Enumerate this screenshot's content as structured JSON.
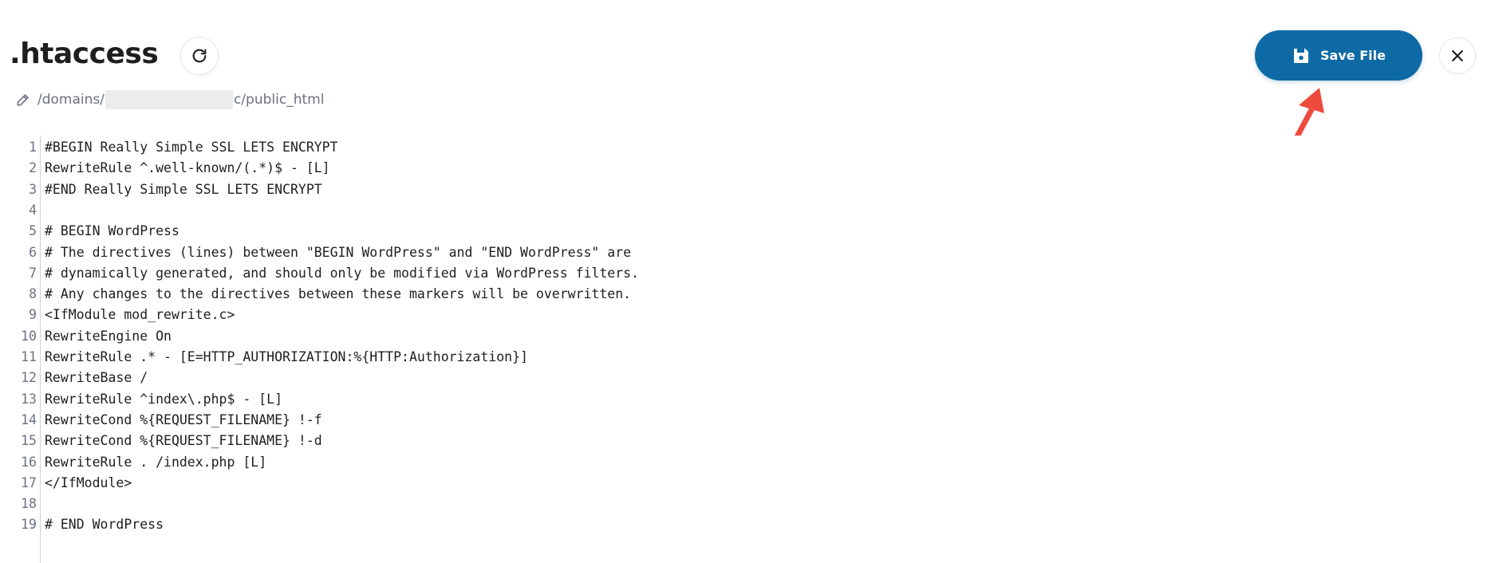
{
  "file": {
    "title": ".htaccess",
    "path_prefix": "/domains/",
    "path_suffix": "c/public_html"
  },
  "toolbar": {
    "save_label": "Save File"
  },
  "icons": {
    "refresh": "refresh-icon",
    "edit": "pencil-icon",
    "save": "floppy-disk-icon",
    "close": "close-icon",
    "annotation": "red-arrow-icon"
  },
  "colors": {
    "accent": "#0e6aa5",
    "annotation_arrow": "#ee4b3f",
    "text": "#1d1e20",
    "muted": "#6d7081"
  },
  "editor": {
    "lines": [
      {
        "num": "1",
        "text": "#BEGIN Really Simple SSL LETS ENCRYPT"
      },
      {
        "num": "2",
        "text": "RewriteRule ^.well-known/(.*)$ - [L]"
      },
      {
        "num": "3",
        "text": "#END Really Simple SSL LETS ENCRYPT"
      },
      {
        "num": "4",
        "text": ""
      },
      {
        "num": "5",
        "text": "# BEGIN WordPress"
      },
      {
        "num": "6",
        "text": "# The directives (lines) between \"BEGIN WordPress\" and \"END WordPress\" are"
      },
      {
        "num": "7",
        "text": "# dynamically generated, and should only be modified via WordPress filters."
      },
      {
        "num": "8",
        "text": "# Any changes to the directives between these markers will be overwritten."
      },
      {
        "num": "9",
        "text": "<IfModule mod_rewrite.c>"
      },
      {
        "num": "10",
        "text": "RewriteEngine On"
      },
      {
        "num": "11",
        "text": "RewriteRule .* - [E=HTTP_AUTHORIZATION:%{HTTP:Authorization}]"
      },
      {
        "num": "12",
        "text": "RewriteBase /"
      },
      {
        "num": "13",
        "text": "RewriteRule ^index\\.php$ - [L]"
      },
      {
        "num": "14",
        "text": "RewriteCond %{REQUEST_FILENAME} !-f"
      },
      {
        "num": "15",
        "text": "RewriteCond %{REQUEST_FILENAME} !-d"
      },
      {
        "num": "16",
        "text": "RewriteRule . /index.php [L]"
      },
      {
        "num": "17",
        "text": "</IfModule>"
      },
      {
        "num": "18",
        "text": ""
      },
      {
        "num": "19",
        "text": "# END WordPress"
      }
    ]
  }
}
